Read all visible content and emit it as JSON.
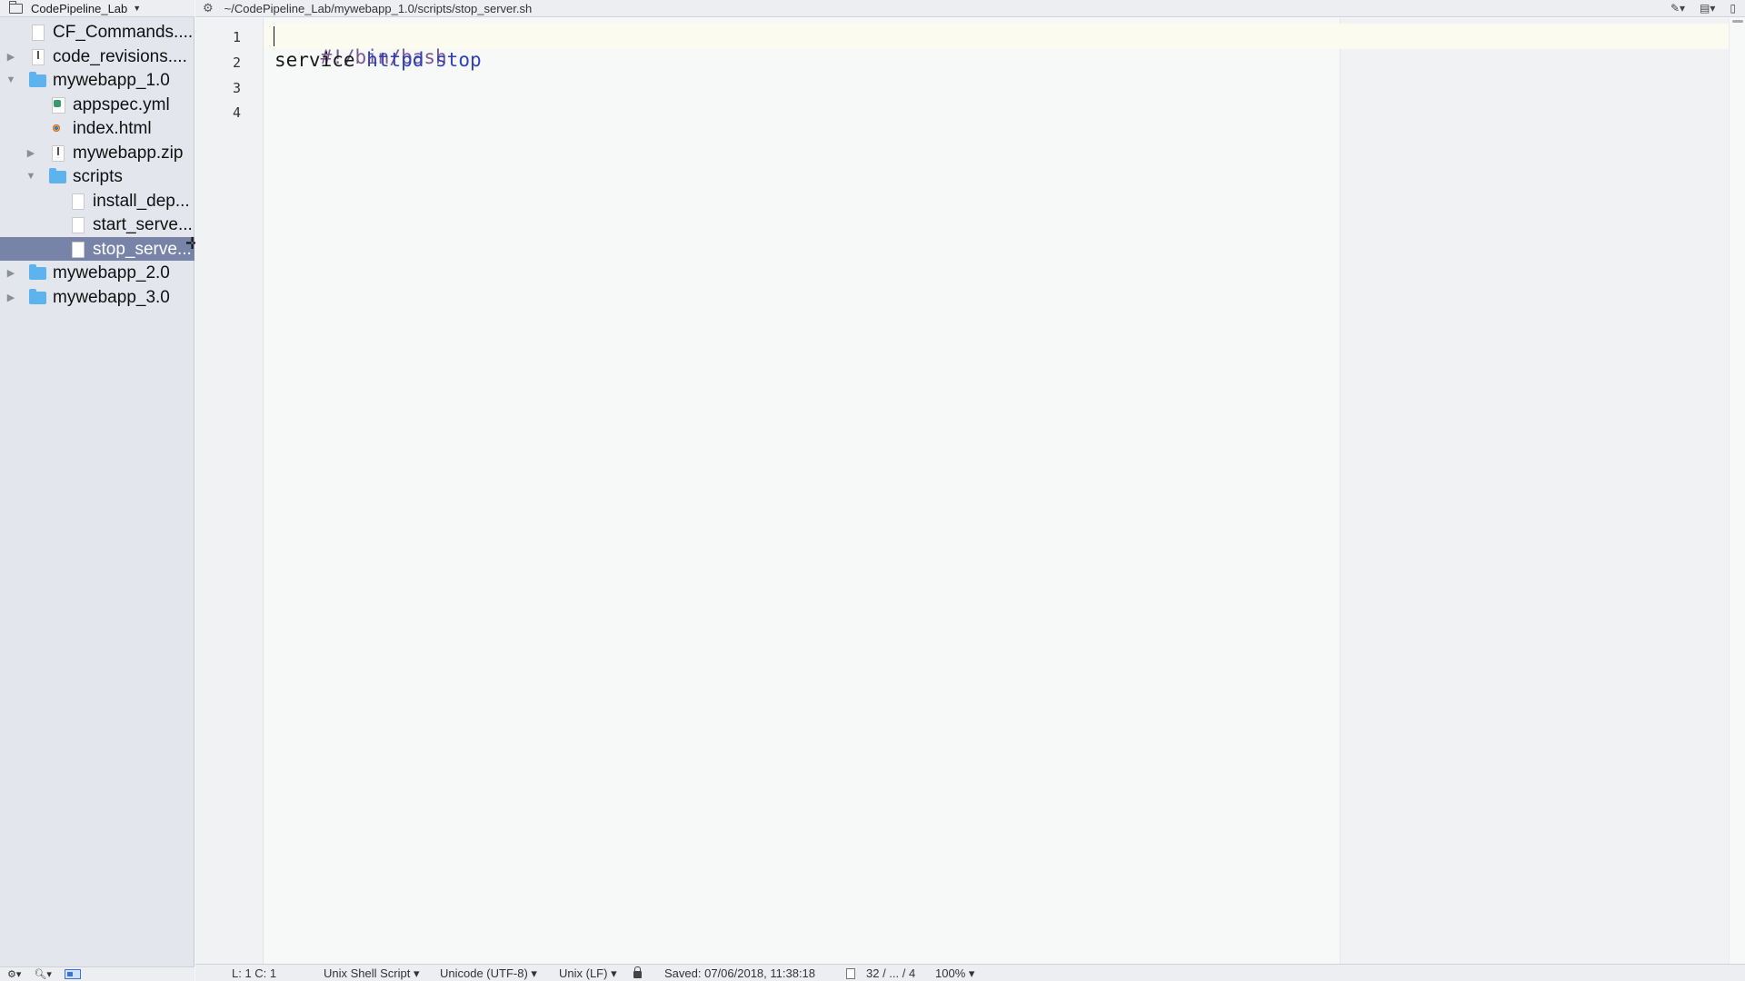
{
  "sidebar": {
    "project_name": "CodePipeline_Lab",
    "items": [
      {
        "label": "CF_Commands....",
        "icon": "document-icon",
        "depth": 1,
        "disclosure": ""
      },
      {
        "label": "code_revisions....",
        "icon": "zip-icon",
        "depth": 1,
        "disclosure": "▶"
      },
      {
        "label": "mywebapp_1.0",
        "icon": "folder-icon",
        "depth": 1,
        "disclosure": "▼"
      },
      {
        "label": "appspec.yml",
        "icon": "yml-icon",
        "depth": 2,
        "disclosure": ""
      },
      {
        "label": "index.html",
        "icon": "html-icon",
        "depth": 2,
        "disclosure": ""
      },
      {
        "label": "mywebapp.zip",
        "icon": "zip-icon",
        "depth": 2,
        "disclosure": "▶"
      },
      {
        "label": "scripts",
        "icon": "folder-icon",
        "depth": 2,
        "disclosure": "▼"
      },
      {
        "label": "install_dep...",
        "icon": "document-icon",
        "depth": 3,
        "disclosure": ""
      },
      {
        "label": "start_serve...",
        "icon": "document-icon",
        "depth": 3,
        "disclosure": ""
      },
      {
        "label": "stop_serve...",
        "icon": "document-icon",
        "depth": 3,
        "disclosure": "",
        "selected": true
      },
      {
        "label": "mywebapp_2.0",
        "icon": "folder-icon",
        "depth": 1,
        "disclosure": "▶"
      },
      {
        "label": "mywebapp_3.0",
        "icon": "folder-icon",
        "depth": 1,
        "disclosure": "▶"
      }
    ]
  },
  "editor": {
    "file_path": "~/CodePipeline_Lab/mywebapp_1.0/scripts/stop_server.sh",
    "line_numbers": [
      "1",
      "2",
      "3",
      "4"
    ],
    "lines": {
      "l1_comment": "#!/bin/bash",
      "l2_cmd": "service ",
      "l2_kw1": "httpd",
      "l2_space": " ",
      "l2_kw2": "stop"
    }
  },
  "status": {
    "position": "L: 1 C: 1",
    "language": "Unix Shell Script",
    "encoding": "Unicode (UTF-8)",
    "line_endings": "Unix (LF)",
    "saved": "Saved: 07/06/2018, 11:38:18",
    "stats": "32 / ... / 4",
    "zoom": "100%"
  },
  "colors": {
    "selection": "#7784a8",
    "folder": "#5cb3ee",
    "keyword": "#2f3fb8",
    "comment": "#7b5a94"
  }
}
